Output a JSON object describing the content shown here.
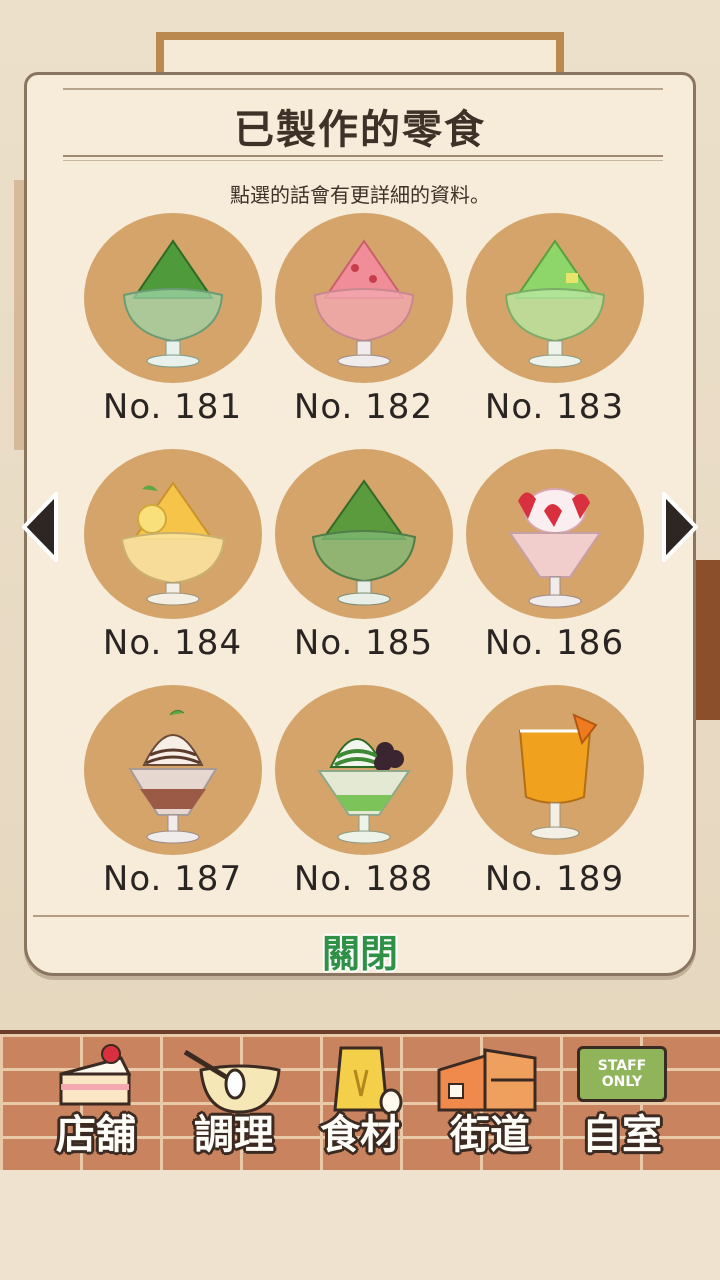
{
  "dialog": {
    "title": "已製作的零食",
    "subtitle": "點選的話會有更詳細的資料。",
    "close_label": "關閉"
  },
  "snacks": [
    {
      "label": "No. 181",
      "icon": "matcha-shaved-ice-icon"
    },
    {
      "label": "No. 182",
      "icon": "strawberry-shaved-ice-icon"
    },
    {
      "label": "No. 183",
      "icon": "melon-shaved-ice-icon"
    },
    {
      "label": "No. 184",
      "icon": "lemon-shaved-ice-icon"
    },
    {
      "label": "No. 185",
      "icon": "uji-matcha-shaved-ice-icon"
    },
    {
      "label": "No. 186",
      "icon": "strawberry-parfait-icon"
    },
    {
      "label": "No. 187",
      "icon": "chocolate-parfait-icon"
    },
    {
      "label": "No. 188",
      "icon": "matcha-anmitsu-parfait-icon"
    },
    {
      "label": "No. 189",
      "icon": "orange-juice-icon"
    }
  ],
  "navigation": {
    "prev": "arrow-left-icon",
    "next": "arrow-right-icon"
  },
  "bottom_nav": [
    {
      "label": "店舖",
      "icon": "cake-icon"
    },
    {
      "label": "調理",
      "icon": "mixing-bowl-icon"
    },
    {
      "label": "食材",
      "icon": "flour-sack-icon"
    },
    {
      "label": "街道",
      "icon": "street-shops-icon"
    },
    {
      "label": "自室",
      "icon": "staff-only-sign-icon"
    }
  ],
  "staff_sign_text": "STAFF ONLY"
}
